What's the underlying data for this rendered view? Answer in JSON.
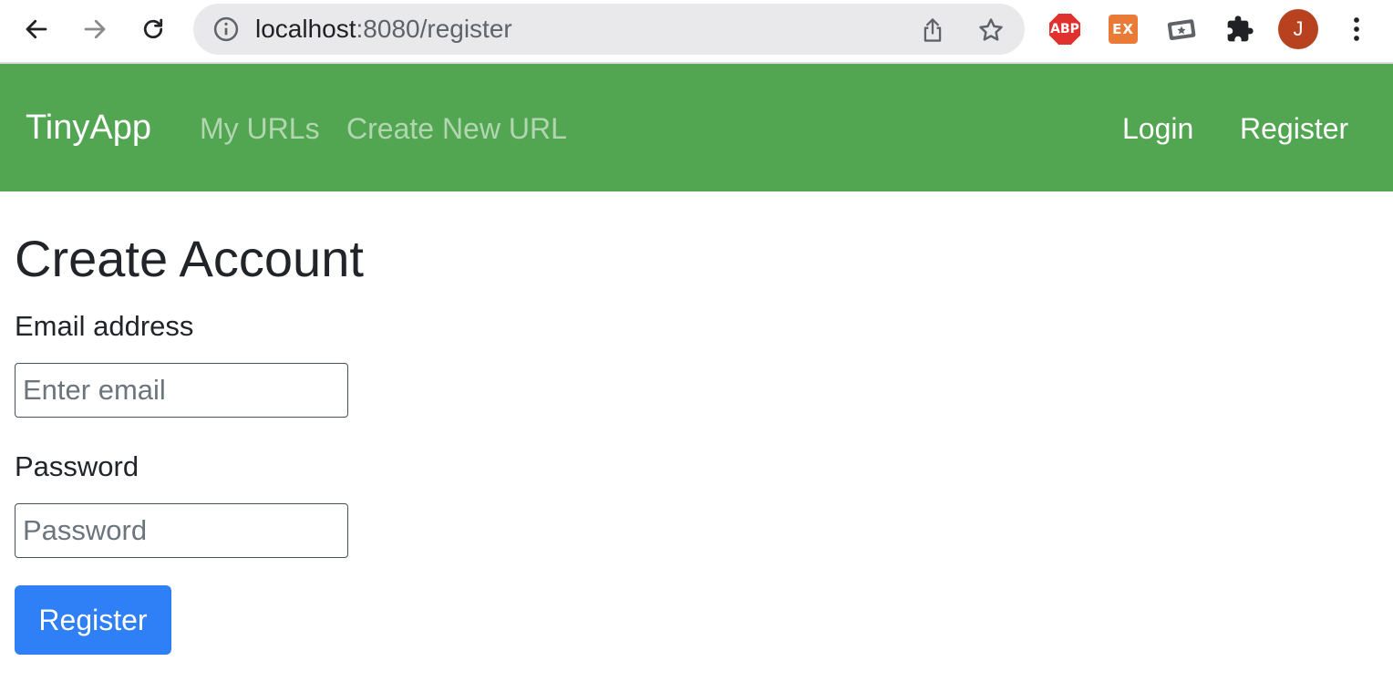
{
  "browser": {
    "url_host": "localhost",
    "url_path": ":8080/register",
    "extensions": {
      "abp_label": "ABP",
      "ex_label": "EX"
    },
    "profile_initial": "J",
    "icons": [
      "back-arrow-icon",
      "forward-arrow-icon",
      "reload-icon",
      "info-icon",
      "share-icon",
      "star-icon",
      "puzzle-icon",
      "ticket-icon",
      "kebab-menu-icon"
    ]
  },
  "navbar": {
    "brand": "TinyApp",
    "links_left": [
      "My URLs",
      "Create New URL"
    ],
    "links_right": [
      "Login",
      "Register"
    ],
    "color": "#52a551"
  },
  "form": {
    "title": "Create Account",
    "email_label": "Email address",
    "email_placeholder": "Enter email",
    "password_label": "Password",
    "password_placeholder": "Password",
    "submit_label": "Register",
    "submit_color": "#2f7ff6"
  }
}
